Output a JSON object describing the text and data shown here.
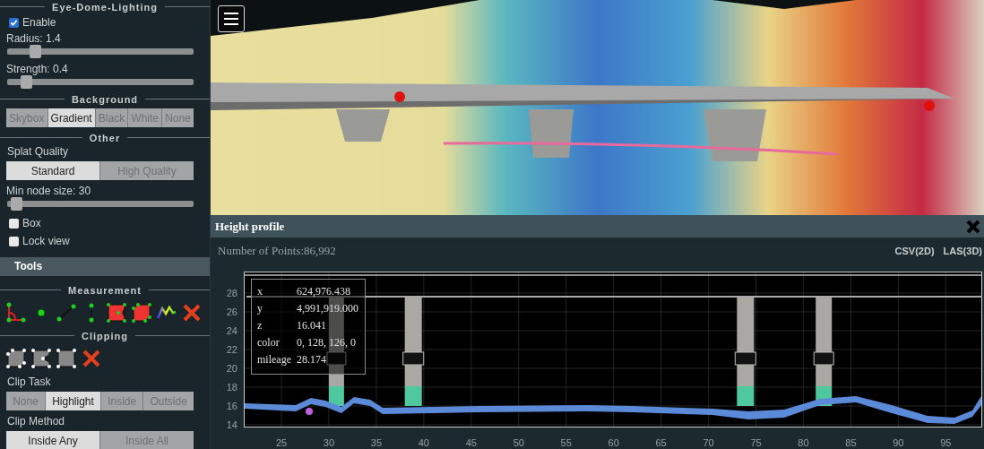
{
  "sidebar": {
    "edl": {
      "heading": "Eye-Dome-Lighting",
      "enable": {
        "label": "Enable",
        "checked": true
      },
      "sliders": [
        {
          "label": "Radius: 1.4",
          "level": 0.13
        },
        {
          "label": "Strength: 0.4",
          "level": 0.08
        }
      ]
    },
    "background": {
      "heading": "Background",
      "options": [
        {
          "label": "Skybox",
          "selected": false
        },
        {
          "label": "Gradient",
          "selected": true
        },
        {
          "label": "Black",
          "selected": false
        },
        {
          "label": "White",
          "selected": false
        },
        {
          "label": "None",
          "selected": false
        }
      ]
    },
    "other": {
      "heading": "Other",
      "splat_label": "Splat Quality",
      "splat_options": [
        {
          "label": "Standard",
          "selected": true
        },
        {
          "label": "High Quality",
          "selected": false
        }
      ],
      "min_node": {
        "label": "Min node size: 30",
        "level": 0.03
      },
      "checkboxes": [
        {
          "label": "Box",
          "checked": false
        },
        {
          "label": "Lock view",
          "checked": false
        }
      ]
    },
    "tools_header": "Tools",
    "measurement": {
      "heading": "Measurement"
    },
    "clipping": {
      "heading": "Clipping",
      "task_label": "Clip Task",
      "task_options": [
        {
          "label": "None",
          "selected": false
        },
        {
          "label": "Highlight",
          "selected": true
        },
        {
          "label": "Inside",
          "selected": false
        },
        {
          "label": "Outside",
          "selected": false
        }
      ],
      "method_label": "Clip Method",
      "method_options": [
        {
          "label": "Inside Any",
          "selected": true
        },
        {
          "label": "Inside All",
          "selected": false
        }
      ]
    }
  },
  "profile": {
    "title": "Height profile",
    "points": "Number of Points:86,992",
    "exports": [
      "CSV(2D)",
      "LAS(3D)"
    ],
    "tooltip": [
      {
        "key": "x",
        "value": "624,976.438"
      },
      {
        "key": "y",
        "value": "4,991,919.000"
      },
      {
        "key": "z",
        "value": "16.041"
      },
      {
        "key": "color",
        "value": "0, 128, 126, 0"
      },
      {
        "key": "mileage",
        "value": "28.174"
      }
    ],
    "yticks": [
      "28",
      "26",
      "24",
      "22",
      "20",
      "18",
      "16",
      "14"
    ],
    "xticks": [
      "25",
      "30",
      "35",
      "40",
      "45",
      "50",
      "55",
      "60",
      "65",
      "70",
      "75",
      "80",
      "85",
      "90",
      "95"
    ]
  }
}
